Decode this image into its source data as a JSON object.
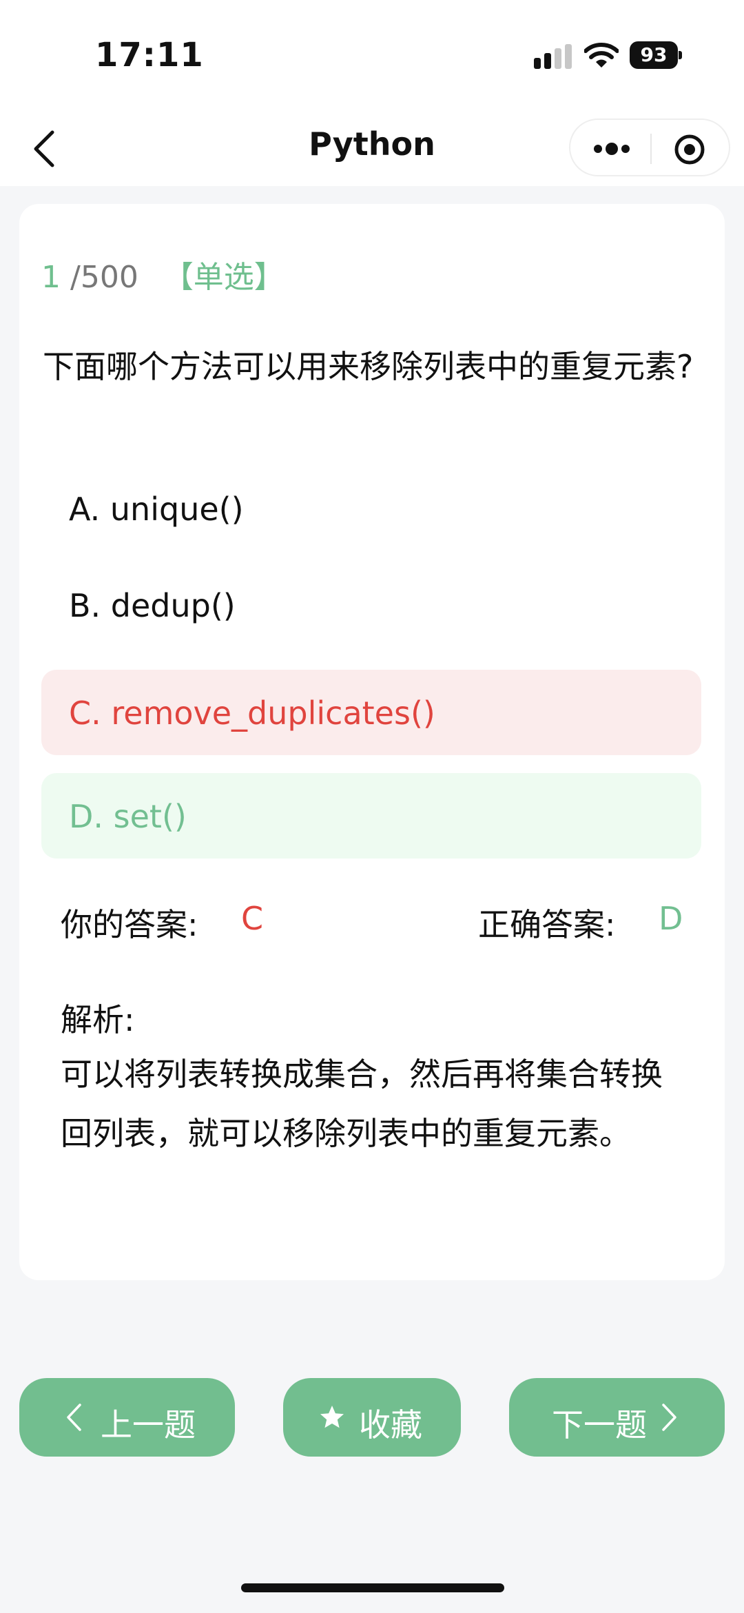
{
  "status": {
    "time": "17:11",
    "battery": "93"
  },
  "nav": {
    "title": "Python"
  },
  "question": {
    "current": "1",
    "total": "/500",
    "type": "【单选】",
    "text": "下面哪个方法可以用来移除列表中的重复元素?",
    "options": [
      {
        "label": "A. unique()"
      },
      {
        "label": "B. dedup()"
      },
      {
        "label": "C. remove_duplicates()"
      },
      {
        "label": "D. set()"
      }
    ]
  },
  "result": {
    "your_label": "你的答案:",
    "your_answer": "C",
    "correct_label": "正确答案:",
    "correct_answer": "D"
  },
  "analysis": {
    "label": "解析:",
    "text": "可以将列表转换成集合，然后再将集合转换回列表，就可以移除列表中的重复元素。"
  },
  "buttons": {
    "prev": "上一题",
    "favorite": "收藏",
    "next": "下一题"
  },
  "colors": {
    "accent": "#72be8f",
    "wrong": "#e0443e",
    "wrong_bg": "#fbecec",
    "correct_bg": "#eefbf1"
  }
}
